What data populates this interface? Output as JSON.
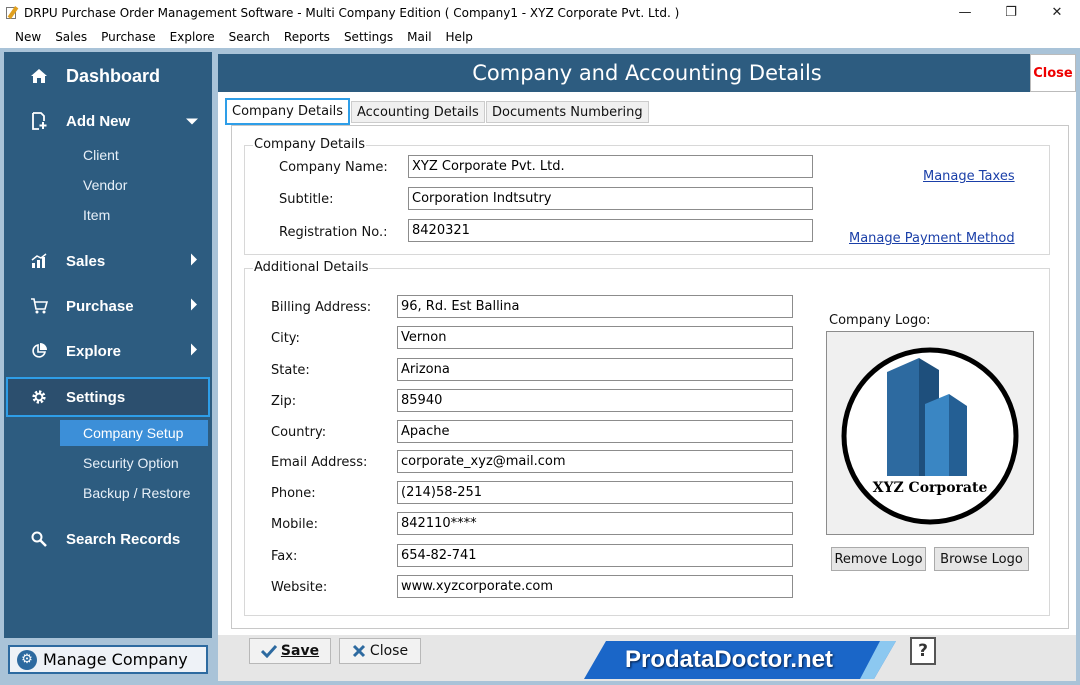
{
  "window": {
    "title": "DRPU Purchase Order Management Software - Multi Company Edition ( Company1 - XYZ Corporate Pvt. Ltd. )",
    "minimize": "—",
    "maximize": "❐",
    "close": "✕"
  },
  "menu": [
    "New",
    "Sales",
    "Purchase",
    "Explore",
    "Search",
    "Reports",
    "Settings",
    "Mail",
    "Help"
  ],
  "sidebar": {
    "dashboard": "Dashboard",
    "add_new": "Add New",
    "add_new_items": [
      "Client",
      "Vendor",
      "Item"
    ],
    "sales": "Sales",
    "purchase": "Purchase",
    "explore": "Explore",
    "settings": "Settings",
    "settings_items": [
      "Company Setup",
      "Security Option",
      "Backup / Restore"
    ],
    "search_records": "Search Records",
    "manage_company": "Manage Company"
  },
  "header": {
    "title": "Company and Accounting Details",
    "close": "Close"
  },
  "tabs": [
    "Company Details",
    "Accounting Details",
    "Documents Numbering"
  ],
  "company_details": {
    "group_label": "Company Details",
    "company_name_label": "Company Name:",
    "company_name": "XYZ Corporate Pvt. Ltd.",
    "subtitle_label": "Subtitle:",
    "subtitle": "Corporation Indtsutry",
    "registration_label": "Registration No.:",
    "registration": "8420321",
    "manage_taxes": "Manage Taxes",
    "manage_payment": "Manage Payment Method"
  },
  "additional_details": {
    "group_label": "Additional Details",
    "billing_address_label": "Billing Address:",
    "billing_address": "96, Rd. Est Ballina",
    "city_label": "City:",
    "city": "Vernon",
    "state_label": "State:",
    "state": "Arizona",
    "zip_label": "Zip:",
    "zip": "85940",
    "country_label": "Country:",
    "country": "Apache",
    "email_label": "Email Address:",
    "email": "corporate_xyz@mail.com",
    "phone_label": "Phone:",
    "phone": "(214)58-251",
    "mobile_label": "Mobile:",
    "mobile": "842110****",
    "fax_label": "Fax:",
    "fax": "654-82-741",
    "website_label": "Website:",
    "website": "www.xyzcorporate.com"
  },
  "logo": {
    "label": "Company Logo:",
    "logo_text": "XYZ Corporate",
    "remove": "Remove Logo",
    "browse": "Browse Logo"
  },
  "footer": {
    "save": "Save",
    "close": "Close",
    "help": "?",
    "brand": "ProdataDoctor.net"
  },
  "colors": {
    "sidebar_bg": "#2d5c80",
    "frame_bg": "#a9c3d8",
    "active_sub": "#3c8fd8",
    "highlight_border": "#2e9ee8",
    "close_red": "#e00000",
    "link": "#1a3fa8"
  }
}
